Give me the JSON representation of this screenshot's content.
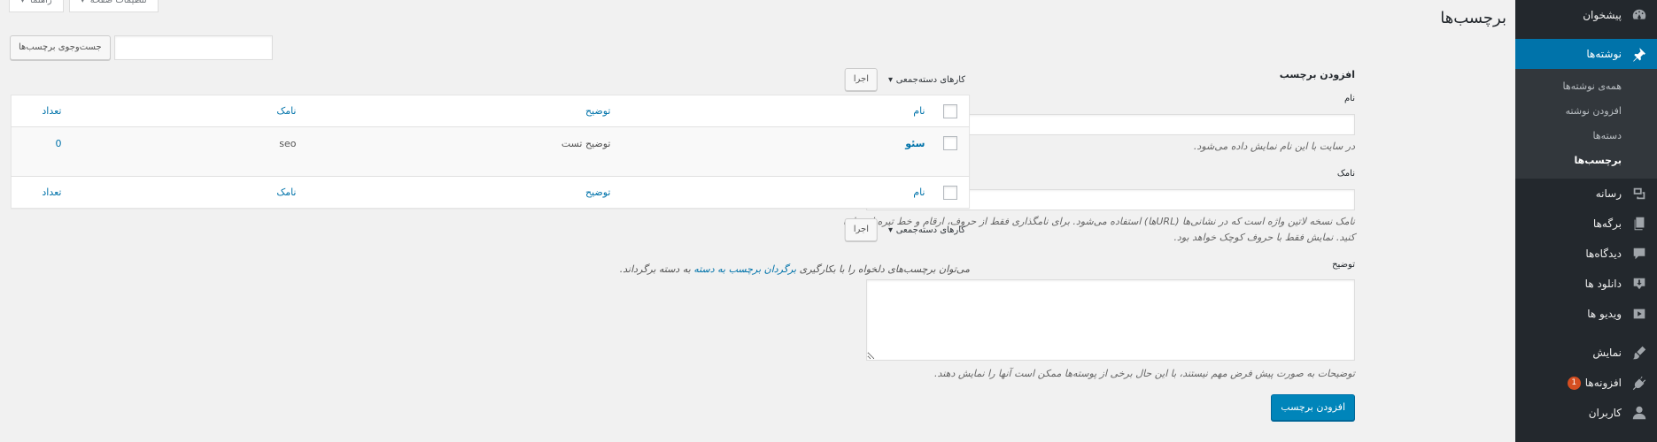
{
  "sidebar": {
    "dashboard": "پیشخوان",
    "posts": "نوشته‌ها",
    "posts_sub": [
      "همه‌ی نوشته‌ها",
      "افزودن نوشته",
      "دسته‌ها",
      "برچسب‌ها"
    ],
    "media": "رسانه",
    "pages": "برگه‌ها",
    "comments": "دیدگاه‌ها",
    "downloads": "دانلود ها",
    "videos": "ویدیو ها",
    "appearance": "نمایش",
    "plugins": "افزونه‌ها",
    "plugins_badge": "1",
    "users": "کاربران"
  },
  "header": {
    "title": "برچسب‌ها",
    "screen_options": "تنظیمات صفحه",
    "help": "راهنما"
  },
  "search": {
    "placeholder": "",
    "button": "جست‌وجوی برچسب‌ها"
  },
  "form": {
    "heading": "افزودن برچسب",
    "name_label": "نام",
    "name_value": "",
    "name_hint": "در سایت با این نام نمایش داده می‌شود.",
    "slug_label": "نامک",
    "slug_value": "",
    "slug_hint": "نامک نسخه لاتین واژه است که در نشانی‌ها (URLها) استفاده می‌شود. برای نامگذاری فقط از حروف، ارقام و خط تیره استفاده کنید. نمایش فقط با حروف کوچک خواهد بود.",
    "desc_label": "توضیح",
    "desc_value": "",
    "desc_hint": "توضیحات به صورت پیش فرض مهم نیستند، با این حال برخی از پوسته‌ها ممکن است آنها را نمایش دهند.",
    "submit": "افزودن برچسب"
  },
  "bulk": {
    "select": "کارهای دسته‌جمعی",
    "apply": "اجرا"
  },
  "table": {
    "headers": {
      "name": "نام",
      "description": "توضیح",
      "slug": "نامک",
      "count": "تعداد"
    },
    "rows": [
      {
        "name": "سئو",
        "description": "توضیح تست",
        "slug": "seo",
        "count": "0"
      }
    ]
  },
  "footer_note": {
    "before": "می‌توان برچسب‌های دلخواه را با بکارگیری",
    "link": "برگردان برچسب به دسته",
    "after": "به دسته برگرداند."
  }
}
